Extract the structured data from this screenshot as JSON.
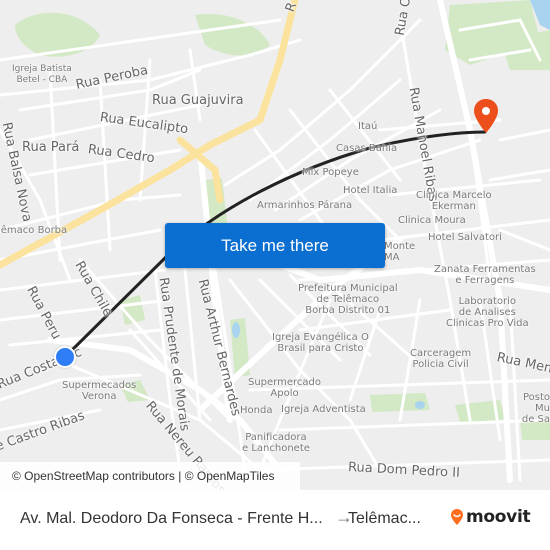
{
  "map": {
    "colors": {
      "background": "#eeeeee",
      "road": "#ffffff",
      "highway": "#fbe39e",
      "park": "#cfe6bf",
      "water": "#a8d4f0",
      "route": "#222222",
      "origin": "#2e7cf6",
      "destination": "#ec4f1c",
      "button": "#0b6ed1"
    },
    "streets": [
      {
        "name": "Rua Peroba"
      },
      {
        "name": "Rua Guajuvira"
      },
      {
        "name": "Rua Eucalipto"
      },
      {
        "name": "Rua Pará"
      },
      {
        "name": "Rua Cedro"
      },
      {
        "name": "Rua Balsa Nova"
      },
      {
        "name": "Rua Chile"
      },
      {
        "name": "Rua Peru"
      },
      {
        "name": "Rua Prudente de Morais"
      },
      {
        "name": "Rua Arthur Bernardes"
      },
      {
        "name": "Rua Nereu Ramos"
      },
      {
        "name": "Rua Costa Ric"
      },
      {
        "name": "e Castro Ribas"
      },
      {
        "name": "Rua Manoel Ribas"
      },
      {
        "name": "Rua O"
      },
      {
        "name": "R"
      },
      {
        "name": "Rua Dom Pedro II"
      },
      {
        "name": "Rua Mem"
      }
    ],
    "pois": [
      {
        "name": "Igreja Batista\nBetel - CBA"
      },
      {
        "name": "Itaú"
      },
      {
        "name": "Casas Bahia"
      },
      {
        "name": "Mix Popeye"
      },
      {
        "name": "Hotel Italia"
      },
      {
        "name": "Armarinhos Párana"
      },
      {
        "name": "Clinica Marcelo\nEkerman"
      },
      {
        "name": "Clinica Moura"
      },
      {
        "name": "Hotel Salvatori"
      },
      {
        "name": "Monte\nMA"
      },
      {
        "name": "Zanata Ferramentas\ne Ferragens"
      },
      {
        "name": "Prefeitura Municipal\nde Telêmaco\nBorba Distrito 01"
      },
      {
        "name": "Laboratorio\nde Analises\nClinicas Pro Vida"
      },
      {
        "name": "Igreja Evangélica O\nBrasil para Cristo"
      },
      {
        "name": "Carceragem\nPolicia Civil"
      },
      {
        "name": "Supermecados\nVerona"
      },
      {
        "name": "Supermercado\nApolo"
      },
      {
        "name": "Honda"
      },
      {
        "name": "Igreja Adventista"
      },
      {
        "name": "Panificadora\ne Lanchonete"
      },
      {
        "name": "Posto Mu\nde Sa"
      },
      {
        "name": "lêmaco Borba"
      }
    ]
  },
  "action_button": {
    "label": "Take me there"
  },
  "attribution": {
    "osm": "© OpenStreetMap contributors",
    "separator": " | ",
    "omt": "© OpenMapTiles"
  },
  "footer": {
    "from": "Av. Mal. Deodoro Da Fonseca - Frente H...",
    "arrow": "→",
    "to": "Telêmac...",
    "brand": "moovit",
    "brand_color": "#ff6e1e"
  }
}
